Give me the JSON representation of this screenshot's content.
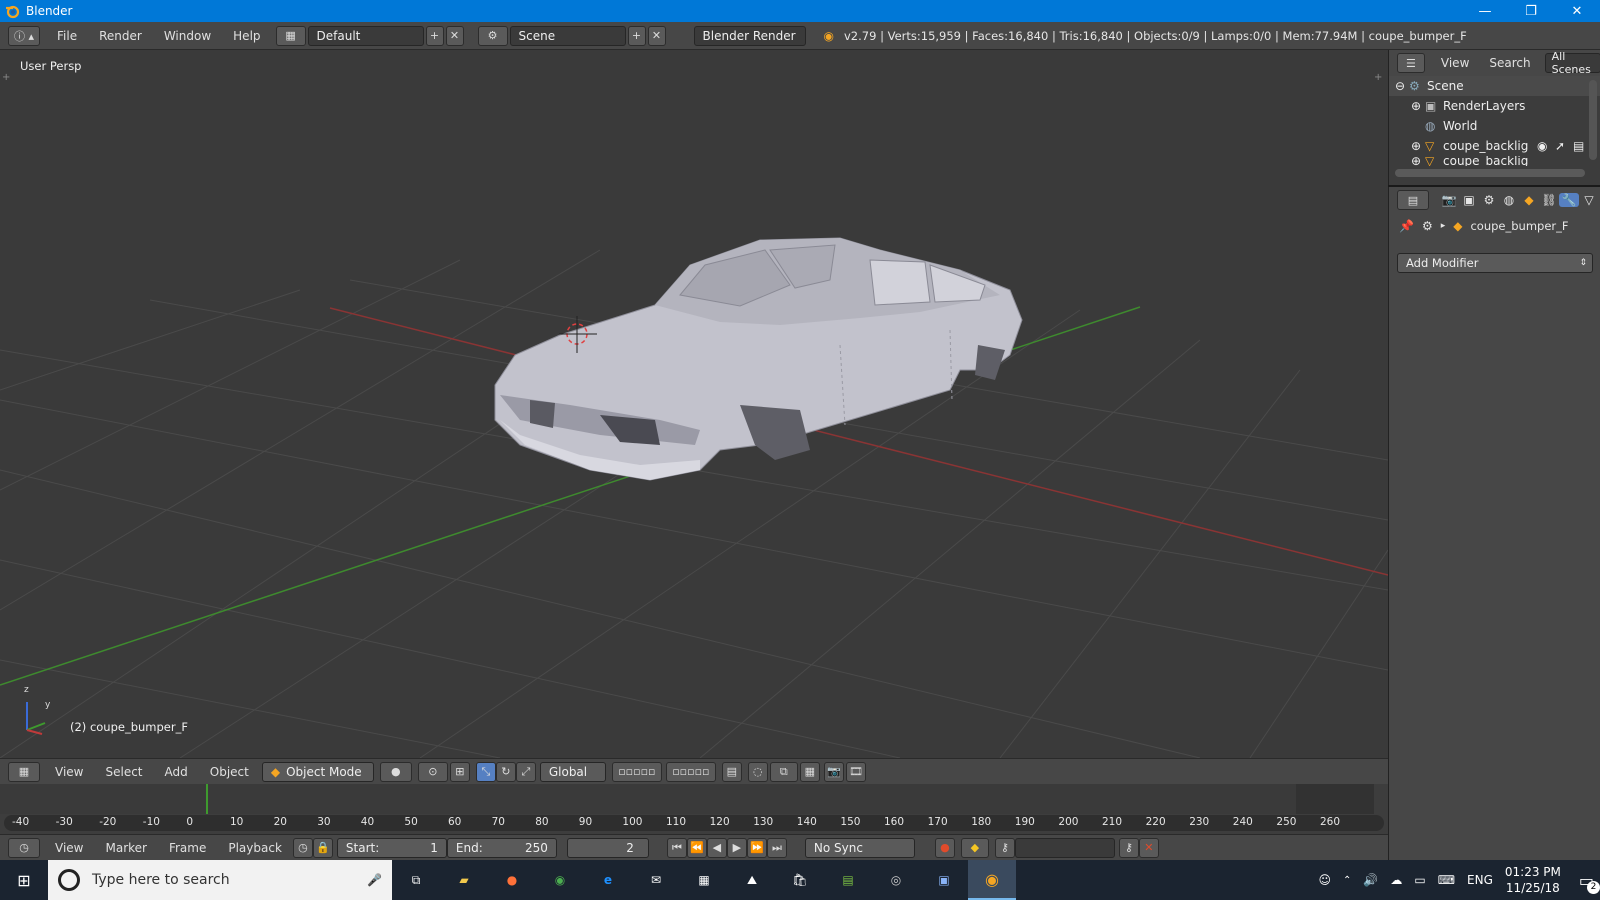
{
  "window": {
    "title": "Blender",
    "minimize": "—",
    "restore": "❐",
    "close": "✕"
  },
  "menubar": {
    "menus": [
      "File",
      "Render",
      "Window",
      "Help"
    ],
    "layout_field": "Default",
    "scene_field": "Scene",
    "engine": "Blender Render",
    "stats": "v2.79 | Verts:15,959 | Faces:16,840 | Tris:16,840 | Objects:0/9 | Lamps:0/0 | Mem:77.94M | coupe_bumper_F"
  },
  "viewport": {
    "view_label": "User Persp",
    "object_label": "(2) coupe_bumper_F",
    "axis_z": "z",
    "axis_y": "y",
    "colors": {
      "bg": "#3a3a3a",
      "grid": "#4a4a4a",
      "x_axis": "#8a3434",
      "y_axis": "#3e8a2e",
      "car": "#c8c8d2"
    }
  },
  "viewport_header": {
    "menus": [
      "View",
      "Select",
      "Add",
      "Object"
    ],
    "mode": "Object Mode",
    "orientation": "Global"
  },
  "outliner": {
    "menus": [
      "View",
      "Search"
    ],
    "filter": "All Scenes",
    "items": [
      {
        "label": "Scene",
        "icon": "scene-icon"
      },
      {
        "label": "RenderLayers",
        "icon": "renderlayers-icon"
      },
      {
        "label": "World",
        "icon": "world-icon"
      },
      {
        "label": "coupe_backlig",
        "icon": "mesh-icon"
      },
      {
        "label": "coupe_backlig",
        "icon": "mesh-icon"
      }
    ]
  },
  "properties": {
    "object_name": "coupe_bumper_F",
    "add_modifier": "Add Modifier"
  },
  "timeline": {
    "ticks": [
      "-40",
      "-30",
      "-20",
      "-10",
      "0",
      "10",
      "20",
      "30",
      "40",
      "50",
      "60",
      "70",
      "80",
      "90",
      "100",
      "110",
      "120",
      "130",
      "140",
      "150",
      "160",
      "170",
      "180",
      "190",
      "200",
      "210",
      "220",
      "230",
      "240",
      "250",
      "260"
    ],
    "current_frame_marker": "2"
  },
  "timeline_header": {
    "menus": [
      "View",
      "Marker",
      "Frame",
      "Playback"
    ],
    "start_label": "Start:",
    "start_value": "1",
    "end_label": "End:",
    "end_value": "250",
    "current": "2",
    "sync": "No Sync"
  },
  "taskbar": {
    "search_placeholder": "Type here to search",
    "lang": "ENG",
    "time": "01:23 PM",
    "date": "11/25/18",
    "notifications": "2"
  }
}
